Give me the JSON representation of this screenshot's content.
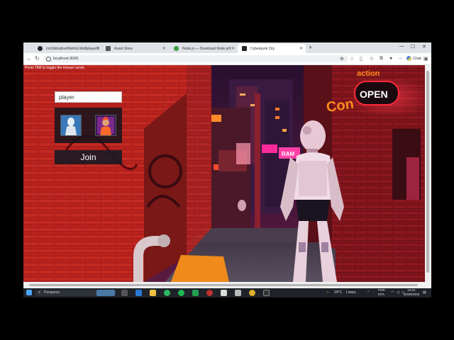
{
  "browser": {
    "tabs": [
      {
        "label": "cici3dstudios/WebGLMultiplayerC",
        "icon": "github-icon",
        "active": false
      },
      {
        "label": "Asset Store",
        "icon": "unity-icon",
        "active": false
      },
      {
        "label": "Node.js — Download Node.js®",
        "icon": "nodejs-icon",
        "active": false
      },
      {
        "label": "Cyberpunk City",
        "icon": "unity-icon",
        "active": true
      }
    ],
    "url": "localhost:3000",
    "chat_label": "Chat"
  },
  "game": {
    "hint": "Press TAB to toggle the mouse cursor.",
    "name_value": "player",
    "join_label": "Join",
    "sign_open": "OPEN",
    "sign_left": "Con",
    "sign_top": "action",
    "sign_small": "RAM"
  },
  "taskbar": {
    "search_placeholder": "Pesquisar",
    "temperature": "24°C",
    "weather": "Limpo",
    "lang_line1": "POR",
    "lang_line2": "INTL",
    "time": "18:02",
    "date": "02/08/2026"
  },
  "colors": {
    "brick": "#8a1a1a",
    "neon_red": "#ff2a3a",
    "neon_orange": "#ff7a1a",
    "neon_pink": "#ff3fa6"
  }
}
